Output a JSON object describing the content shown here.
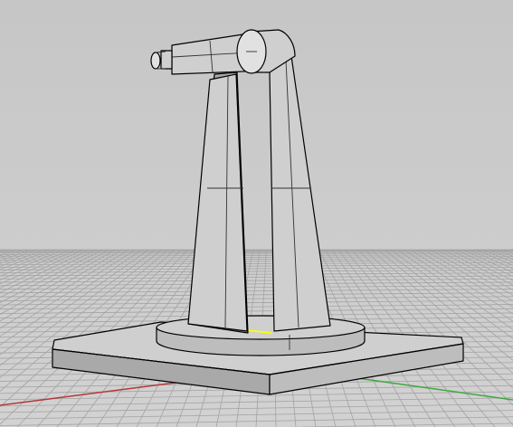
{
  "viewport": {
    "view": "perspective-3d",
    "display_mode": "shaded",
    "colors": {
      "background_top": "#c6c6c6",
      "background_bottom": "#d2d2d2",
      "grid_line": "#a3a3a3",
      "x_axis": "#b23a3a",
      "y_axis": "#3fa83f",
      "object_fill": "#cfcfcf",
      "object_edge": "#000000",
      "selected_edge": "#ffff00"
    }
  },
  "model": {
    "parts": [
      "base-plate",
      "turntable",
      "left-leg",
      "right-leg",
      "shoulder-joint",
      "upper-arm",
      "end-effector"
    ],
    "selected_edge": "turntable-top-edge"
  }
}
